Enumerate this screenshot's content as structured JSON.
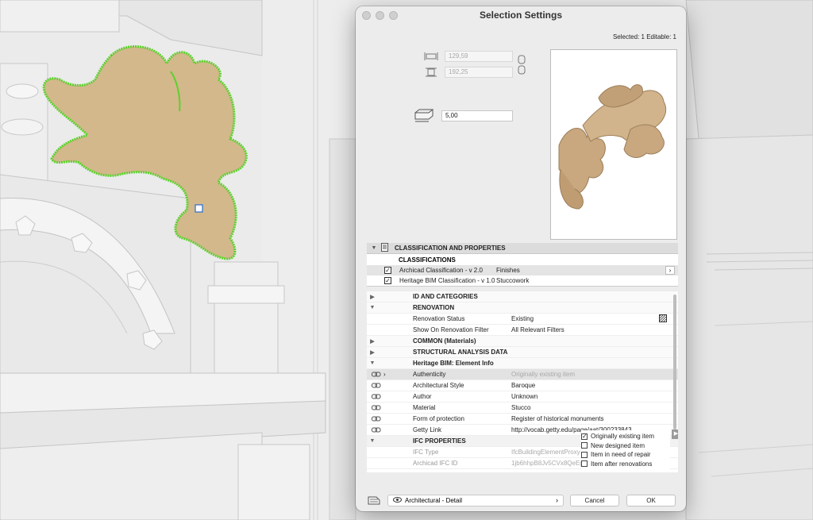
{
  "window": {
    "title": "Selection Settings"
  },
  "selection_info": "Selected: 1 Editable: 1",
  "dimensions": {
    "width": "129,59",
    "depth": "192,25",
    "height": "5,00"
  },
  "panel": {
    "section_title": "CLASSIFICATION AND PROPERTIES",
    "classifications_title": "CLASSIFICATIONS",
    "classifications": [
      {
        "system": "Archicad Classification - v 2.0",
        "value": "Finishes",
        "checked": true
      },
      {
        "system": "Heritage BIM Classification - v 1.0",
        "value": "Stuccowork",
        "checked": true
      }
    ],
    "groups": {
      "id": "ID AND CATEGORIES",
      "renovation": "RENOVATION",
      "common": "COMMON (Materials)",
      "structural": "STRUCTURAL ANALYSIS DATA",
      "heritage": "Heritage BIM: Element Info",
      "ifc": "IFC PROPERTIES"
    },
    "renovation": [
      {
        "key": "Renovation Status",
        "value": "Existing"
      },
      {
        "key": "Show On Renovation Filter",
        "value": "All Relevant Filters"
      }
    ],
    "heritage": [
      {
        "key": "Authenticity",
        "value": "Originally existing item"
      },
      {
        "key": "Architectural Style",
        "value": "Baroque"
      },
      {
        "key": "Author",
        "value": "Unknown"
      },
      {
        "key": "Material",
        "value": "Stucco"
      },
      {
        "key": "Form of protection",
        "value": "Register of historical monuments"
      },
      {
        "key": "Getty Link",
        "value": "http://vocab.getty.edu/page/aat/300233843"
      }
    ],
    "ifc": [
      {
        "key": "IFC Type",
        "value": "IfcBuildingElementProxy"
      },
      {
        "key": "Archicad IFC ID",
        "value": "1jb6hhpB8Jv5CVx8QeEgk"
      }
    ],
    "authenticity_options": [
      {
        "label": "Originally existing item",
        "checked": true
      },
      {
        "label": "New designed item",
        "checked": false
      },
      {
        "label": "Item in need of repair",
        "checked": false
      },
      {
        "label": "Item after renovations",
        "checked": false
      }
    ]
  },
  "footer": {
    "favorite": "Architectural - Detail",
    "cancel": "Cancel",
    "ok": "OK"
  },
  "colors": {
    "selection_green": "#5bd12e",
    "ornament": "#d3b88b",
    "dialog_bg": "#ececec"
  }
}
